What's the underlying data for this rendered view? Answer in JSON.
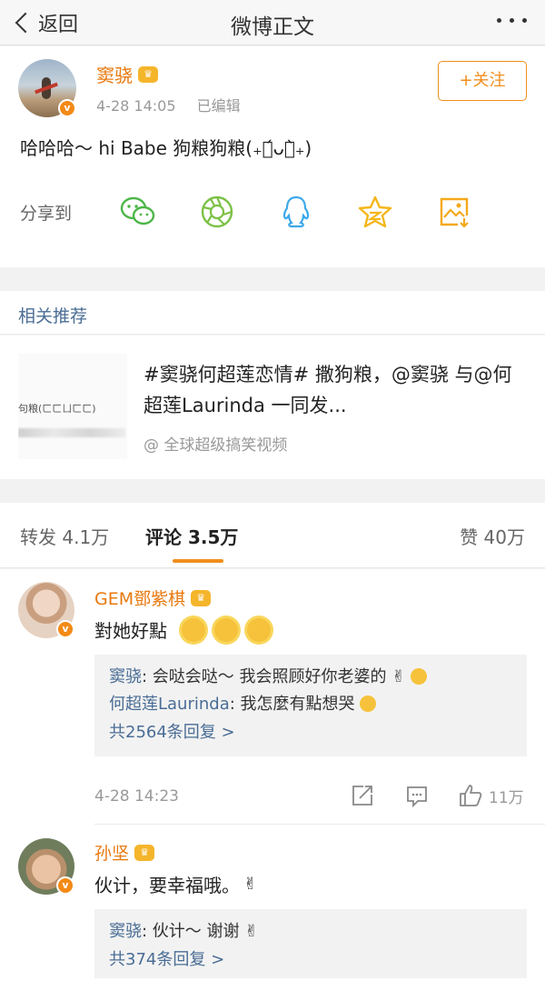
{
  "nav": {
    "back_label": "返回",
    "title": "微博正文"
  },
  "post": {
    "author": "窦骁",
    "time": "4-28 14:05",
    "edited": "已编辑",
    "follow_label": "+关注",
    "content": "哈哈哈～ hi Babe 狗粮狗粮(₊๑́ᴗ๑̀₊)",
    "share_label": "分享到"
  },
  "related": {
    "heading": "相关推荐",
    "title": "#窦骁何超莲恋情# 撒狗粮，@窦骁 与@何超莲Laurinda 一同发...",
    "source": "@ 全球超级搞笑视频",
    "thumb_text": "句粮(ㄈㄈㄩㄈㄈ)"
  },
  "tabs": {
    "repost": "转发 4.1万",
    "comments": "评论 3.5万",
    "likes": "赞 40万"
  },
  "comments": [
    {
      "name": "GEM鄧紫棋",
      "text": "對她好點",
      "replies": [
        {
          "name": "窦骁",
          "text": ": 会哒会哒～ 我会照顾好你老婆的"
        },
        {
          "name": "何超莲Laurinda",
          "text": ": 我怎麼有點想哭"
        }
      ],
      "more": "共2564条回复 >",
      "time": "4-28 14:23",
      "likes": "11万"
    },
    {
      "name": "孙坚",
      "text": "伙计，要幸福哦。",
      "replies": [
        {
          "name": "窦骁",
          "text": ": 伙计～ 谢谢"
        }
      ],
      "more": "共374条回复 >"
    }
  ],
  "colors": {
    "accent": "#f08e1c",
    "link": "#4a6d95",
    "vip": "#e8790f"
  },
  "icons": [
    "chevron-left-icon",
    "more-icon",
    "wechat-icon",
    "moments-icon",
    "qq-icon",
    "qzone-icon",
    "save-image-icon",
    "verified-icon",
    "vip-crown-icon",
    "share-icon",
    "comment-icon",
    "like-icon"
  ]
}
